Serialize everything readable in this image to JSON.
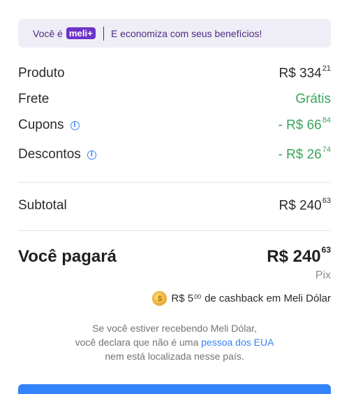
{
  "banner": {
    "prefix": "Você é",
    "badge": "meli+",
    "text": "E economiza com seus benefícios!"
  },
  "summary": {
    "produto": {
      "label": "Produto",
      "value": "R$ 334",
      "cents": "21"
    },
    "frete": {
      "label": "Frete",
      "value": "Grátis"
    },
    "cupons": {
      "label": "Cupons",
      "value": "- R$ 66",
      "cents": "84"
    },
    "descontos": {
      "label": "Descontos",
      "value": "- R$ 26",
      "cents": "74"
    },
    "subtotal": {
      "label": "Subtotal",
      "value": "R$ 240",
      "cents": "63"
    }
  },
  "total": {
    "label": "Você pagará",
    "value": "R$ 240",
    "cents": "63",
    "method": "Pix"
  },
  "cashback": {
    "value": "R$ 5",
    "cents": "00",
    "text": "de cashback em Meli Dólar"
  },
  "disclaimer": {
    "line1": "Se você estiver recebendo Meli Dólar,",
    "line2_before": "você declara que não é uma",
    "line2_link": "pessoa dos EUA",
    "line3": "nem está localizada nesse país."
  },
  "colors": {
    "accent": "#3483fa",
    "green": "#3ba55c",
    "meli_purple": "#6b33c8"
  }
}
